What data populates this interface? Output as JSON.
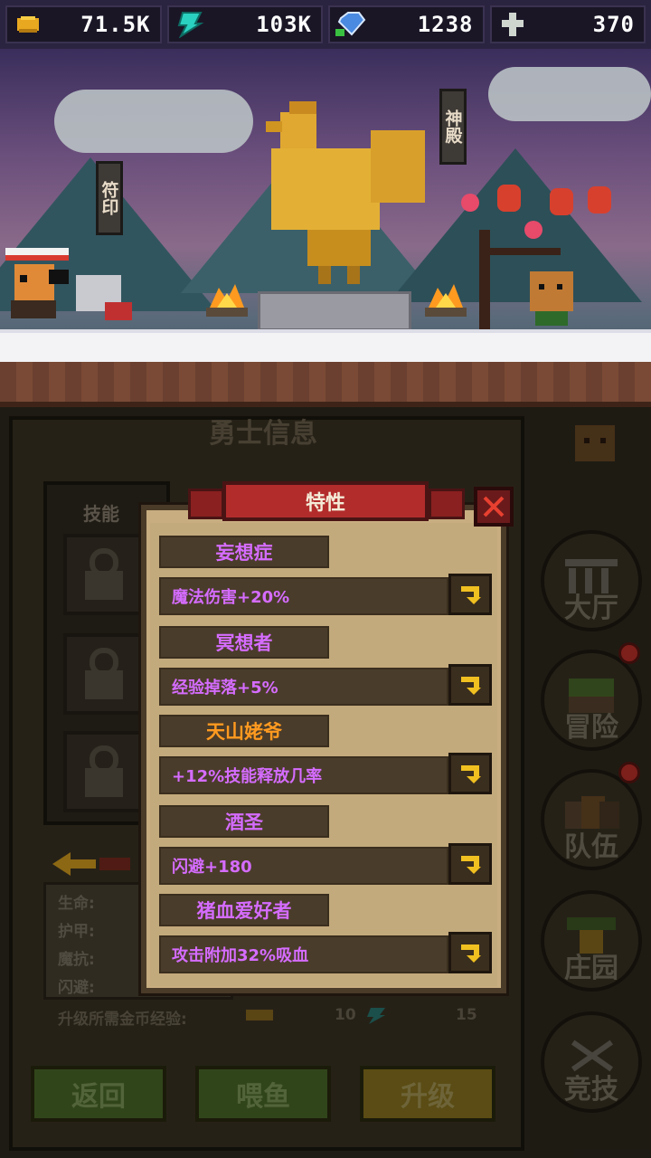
{
  "resources": [
    {
      "name": "gold",
      "icon": "gold-nugget-icon",
      "value": "71.5K"
    },
    {
      "name": "energy",
      "icon": "energy-crystal-icon",
      "value": "103K"
    },
    {
      "name": "gem",
      "icon": "blue-gem-icon",
      "value": "1238"
    },
    {
      "name": "cross",
      "icon": "cross-token-icon",
      "value": "370"
    }
  ],
  "scene": {
    "sign_left": "符印",
    "sign_right": "神殿"
  },
  "hero_panel": {
    "title": "勇士信息",
    "skills_label": "技能",
    "stats": [
      "生命:",
      "护甲:",
      "魔抗:",
      "闪避:"
    ],
    "upgrade_cost_label": "升级所需金币经验:",
    "upgrade_cost_gold": "10",
    "upgrade_cost_exp": "15"
  },
  "buttons": {
    "back": "返回",
    "feed": "喂鱼",
    "upgrade": "升级"
  },
  "nav": [
    {
      "label": "大厅",
      "icon": "hall-icon",
      "badge": false
    },
    {
      "label": "冒险",
      "icon": "adventure-icon",
      "badge": true
    },
    {
      "label": "队伍",
      "icon": "team-icon",
      "badge": true
    },
    {
      "label": "庄园",
      "icon": "manor-icon",
      "badge": false
    },
    {
      "label": "竞技",
      "icon": "arena-swords-icon",
      "badge": false
    }
  ],
  "dialog": {
    "title": "特性",
    "traits": [
      {
        "name": "妄想症",
        "effect": "魔法伤害+20%",
        "name_color": "purple"
      },
      {
        "name": "冥想者",
        "effect": "经验掉落+5%",
        "name_color": "purple"
      },
      {
        "name": "天山姥爷",
        "effect": "+12%技能释放几率",
        "name_color": "orange"
      },
      {
        "name": "酒圣",
        "effect": "闪避+180",
        "name_color": "purple"
      },
      {
        "name": "猪血爱好者",
        "effect": "攻击附加32%吸血",
        "name_color": "purple"
      }
    ]
  }
}
